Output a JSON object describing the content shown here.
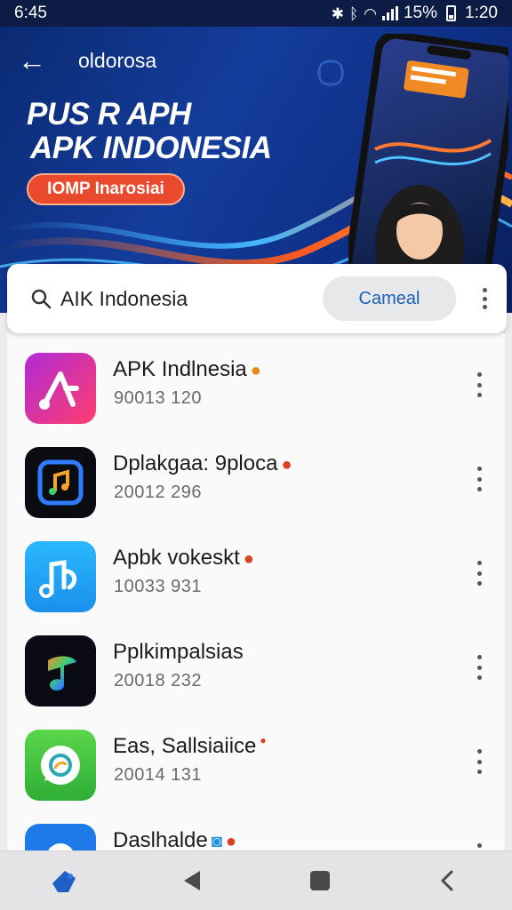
{
  "status_bar": {
    "time": "6:45",
    "battery_percent": "15%",
    "clock_right": "1:20"
  },
  "header": {
    "back_label": "←",
    "subtitle": "oldorosa"
  },
  "banner": {
    "title_line1": "PUS R APH",
    "title_line2": "APK INDONESIA",
    "pill_label": "IOMP Inarosiai"
  },
  "search": {
    "value": "AIK Indonesia",
    "placeholder": "",
    "cancel_label": "Cameal"
  },
  "apps": [
    {
      "name": "APK Indlnesia",
      "meta": "90013 120",
      "icon": "music-note-icon",
      "badge": "fire-badge-icon"
    },
    {
      "name": "Dplakgaa: 9ploca",
      "meta": "20012 296",
      "icon": "music-square-icon",
      "badge": "fire-badge-icon"
    },
    {
      "name": "Apbk vokeskt",
      "meta": "10033 931",
      "icon": "music-notes-icon",
      "badge": "fire-badge-icon"
    },
    {
      "name": "Pplkimpalsias",
      "meta": "20018 232",
      "icon": "gradient-note-icon",
      "badge": ""
    },
    {
      "name": "Eas, Sallsiaiice",
      "meta": "20014 131",
      "icon": "chat-bubble-icon",
      "badge": "dot-badge-icon"
    },
    {
      "name": "Daslhalde",
      "meta": "",
      "icon": "blue-app-icon",
      "badge": "fire-badge-icon"
    }
  ],
  "colors": {
    "hero_blue": "#143d9b",
    "accent_orange": "#e9492d",
    "cancel_text": "#1c5fb6"
  }
}
